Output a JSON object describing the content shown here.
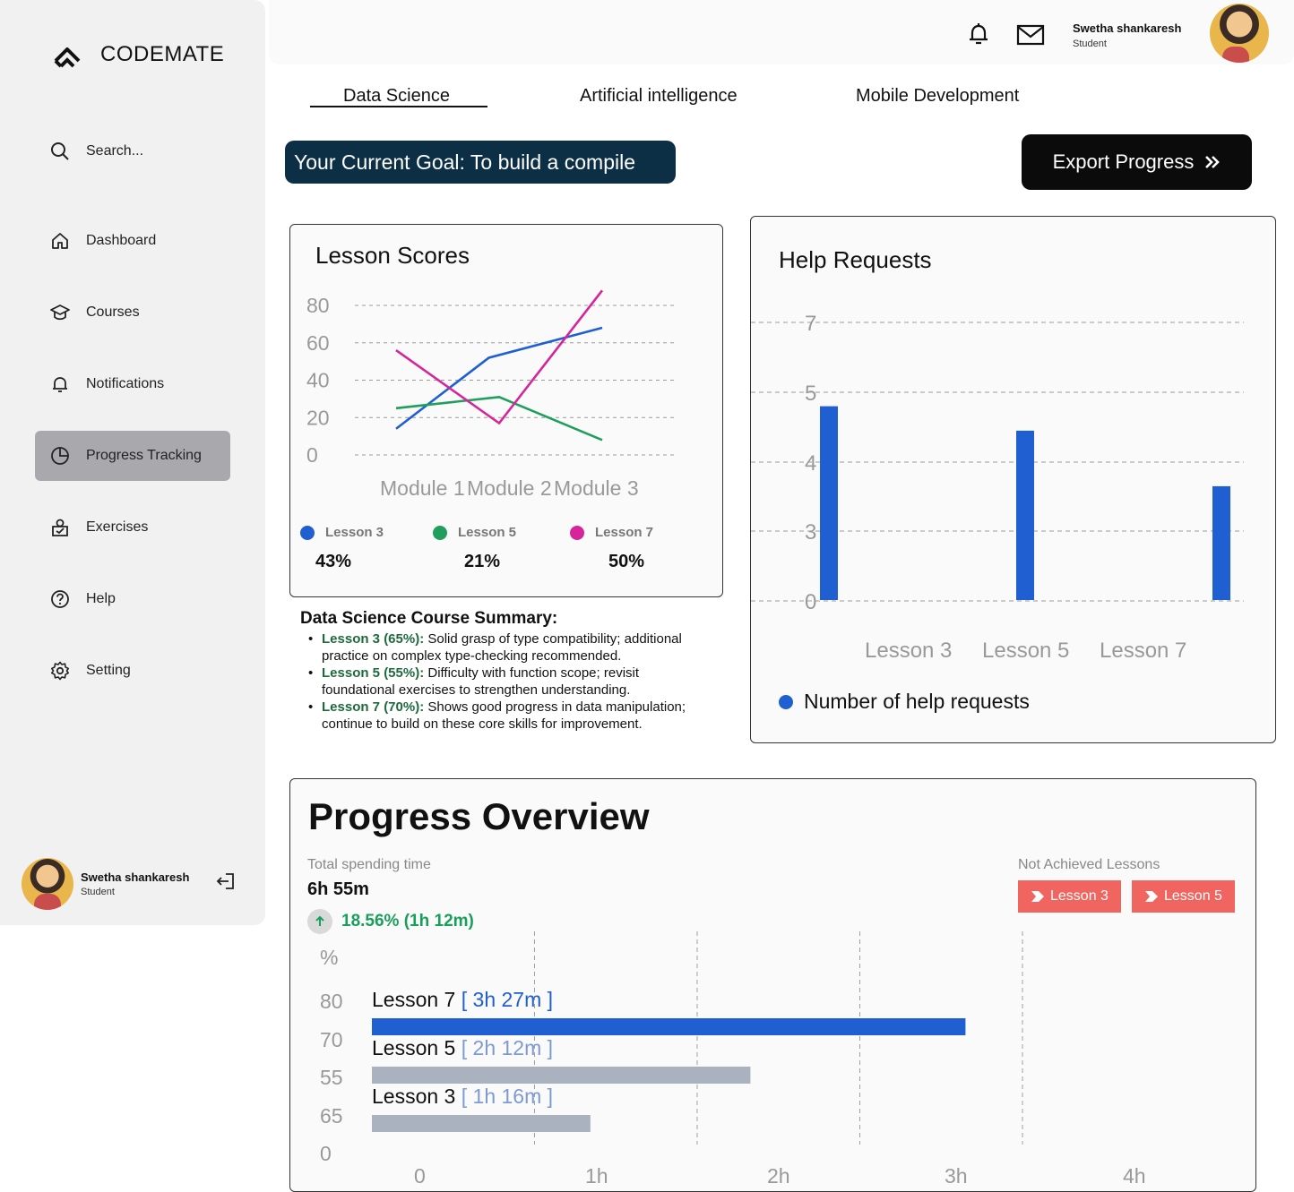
{
  "brand": {
    "name": "CODEMATE"
  },
  "search": {
    "placeholder": "Search..."
  },
  "nav": {
    "dashboard": "Dashboard",
    "courses": "Courses",
    "notifications": "Notifications",
    "progress": "Progress Tracking",
    "exercises": "Exercises",
    "help": "Help",
    "setting": "Setting"
  },
  "user": {
    "name": "Swetha shankaresh",
    "role": "Student"
  },
  "tabs": [
    "Data Science",
    "Artificial intelligence",
    "Mobile Development"
  ],
  "goal": "Your Current Goal: To build a compile",
  "export_label": "Export Progress",
  "lesson_scores": {
    "title": "Lesson Scores",
    "legend": [
      {
        "name": "Lesson 3",
        "pct": "43%",
        "color": "#1f5fd1"
      },
      {
        "name": "Lesson 5",
        "pct": "21%",
        "color": "#1f9e5c"
      },
      {
        "name": "Lesson 7",
        "pct": "50%",
        "color": "#d6259a"
      }
    ]
  },
  "summary": {
    "title": "Data Science Course Summary:",
    "items": [
      {
        "label": "Lesson 3 (65%):",
        "text": " Solid grasp of type compatibility; additional practice on complex type-checking recommended."
      },
      {
        "label": "Lesson 5 (55%):",
        "text": " Difficulty with function scope; revisit foundational exercises to strengthen understanding."
      },
      {
        "label": "Lesson 7 (70%):",
        "text": " Shows good progress in data manipulation; continue to build on these core skills for improvement."
      }
    ]
  },
  "help_requests": {
    "title": "Help Requests",
    "legend": "Number of help requests"
  },
  "progress_overview": {
    "title": "Progress Overview",
    "total_label": "Total spending time",
    "total_value": "6h 55m",
    "delta": "18.56% (1h 12m)",
    "not_achieved_label": "Not Achieved Lessons",
    "not_achieved": [
      "Lesson 3",
      "Lesson 5"
    ]
  },
  "chart_data": [
    {
      "type": "line",
      "title": "Lesson Scores",
      "categories": [
        "Module 1",
        "Module 2",
        "Module 3"
      ],
      "ylim": [
        0,
        80
      ],
      "yticks": [
        0,
        20,
        40,
        60,
        80
      ],
      "grid": true,
      "series": [
        {
          "name": "Lesson 3",
          "color": "#1f5fd1",
          "points": [
            [
              0,
              14
            ],
            [
              0.45,
              52
            ],
            [
              1,
              68
            ]
          ]
        },
        {
          "name": "Lesson 5",
          "color": "#1f9e5c",
          "points": [
            [
              0,
              25
            ],
            [
              0.5,
              31
            ],
            [
              1,
              8
            ]
          ]
        },
        {
          "name": "Lesson 7",
          "color": "#d6259a",
          "points": [
            [
              0,
              56
            ],
            [
              0.5,
              17
            ],
            [
              1,
              88
            ]
          ]
        }
      ]
    },
    {
      "type": "bar",
      "title": "Help Requests",
      "categories": [
        "Lesson 3",
        "Lesson 5",
        "Lesson 7"
      ],
      "yticks": [
        0,
        3,
        4,
        5,
        7
      ],
      "values": [
        4.8,
        4.45,
        3.65
      ],
      "series": [
        {
          "name": "Number of help requests",
          "color": "#1f5fd1"
        }
      ]
    },
    {
      "type": "bar",
      "orientation": "horizontal",
      "categories": [
        "Lesson 7",
        "Lesson 5",
        "Lesson 3"
      ],
      "durations": [
        "[ 3h 27m ]",
        "[ 2h 12m ]",
        "[ 1h 16m ]"
      ],
      "values": [
        3.45,
        2.2,
        1.27
      ],
      "colors": [
        "#1f5fd1",
        "#aab2c0",
        "#aab2c0"
      ],
      "xticks": [
        "0",
        "1h",
        "2h",
        "3h",
        "4h"
      ],
      "yticks": [
        "%",
        "80",
        "70",
        "55",
        "65",
        "0"
      ]
    }
  ]
}
